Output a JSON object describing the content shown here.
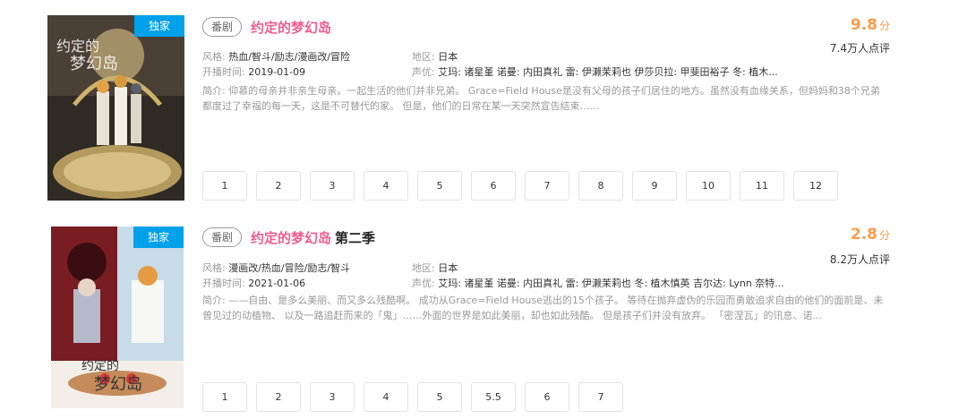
{
  "items": [
    {
      "badge": "独家",
      "tag": "番剧",
      "title": "约定的梦幻岛",
      "title_suffix": "",
      "score": "9.8",
      "score_unit": "分",
      "votes": "7.4万人点评",
      "style_label": "风格:",
      "style_value": "热血/智斗/励志/漫画改/冒险",
      "region_label": "地区:",
      "region_value": "日本",
      "date_label": "开播时间:",
      "date_value": "2019-01-09",
      "cast_label": "声优:",
      "cast_value": "艾玛: 诸星堇 诺曼: 内田真礼 雷: 伊濑茉莉也 伊莎贝拉: 甲斐田裕子 冬: 植木...",
      "intro_label": "简介:",
      "intro_value": "仰慕的母亲并非亲生母亲。一起生活的他们并非兄弟。 Grace=Field House是没有父母的孩子们居住的地方。虽然没有血缘关系，但妈妈和38个兄弟都度过了幸福的每一天，这是不可替代的家。 但是，他们的日常在某一天突然宣告结束……",
      "episodes": [
        "1",
        "2",
        "3",
        "4",
        "5",
        "6",
        "7",
        "8",
        "9",
        "10",
        "11",
        "12"
      ]
    },
    {
      "badge": "独家",
      "tag": "番剧",
      "title": "约定的梦幻岛",
      "title_suffix": "第二季",
      "score": "2.8",
      "score_unit": "分",
      "votes": "8.2万人点评",
      "style_label": "风格:",
      "style_value": "漫画改/热血/冒险/励志/智斗",
      "region_label": "地区:",
      "region_value": "日本",
      "date_label": "开播时间:",
      "date_value": "2021-01-06",
      "cast_label": "声优:",
      "cast_value": "艾玛: 诸星堇 诺曼: 内田真礼 雷: 伊濑茉莉也 冬: 植木慎英 吉尔达: Lynn 奈特...",
      "intro_label": "简介:",
      "intro_value": "——自由、是多么美丽、而又多么残酷啊。 成功从Grace=Field House逃出的15个孩子。 等待在抛弃虚伪的乐园而勇敢追求自由的他们的面前是、未曾见过的动植物、 以及一路追赶而来的「鬼」……外面的世界是如此美丽，却也如此残酷。 但是孩子们并没有放弃。 「密涅瓦」的讯息、诺...",
      "episodes": [
        "1",
        "2",
        "3",
        "4",
        "5",
        "5.5",
        "6",
        "7"
      ]
    }
  ]
}
